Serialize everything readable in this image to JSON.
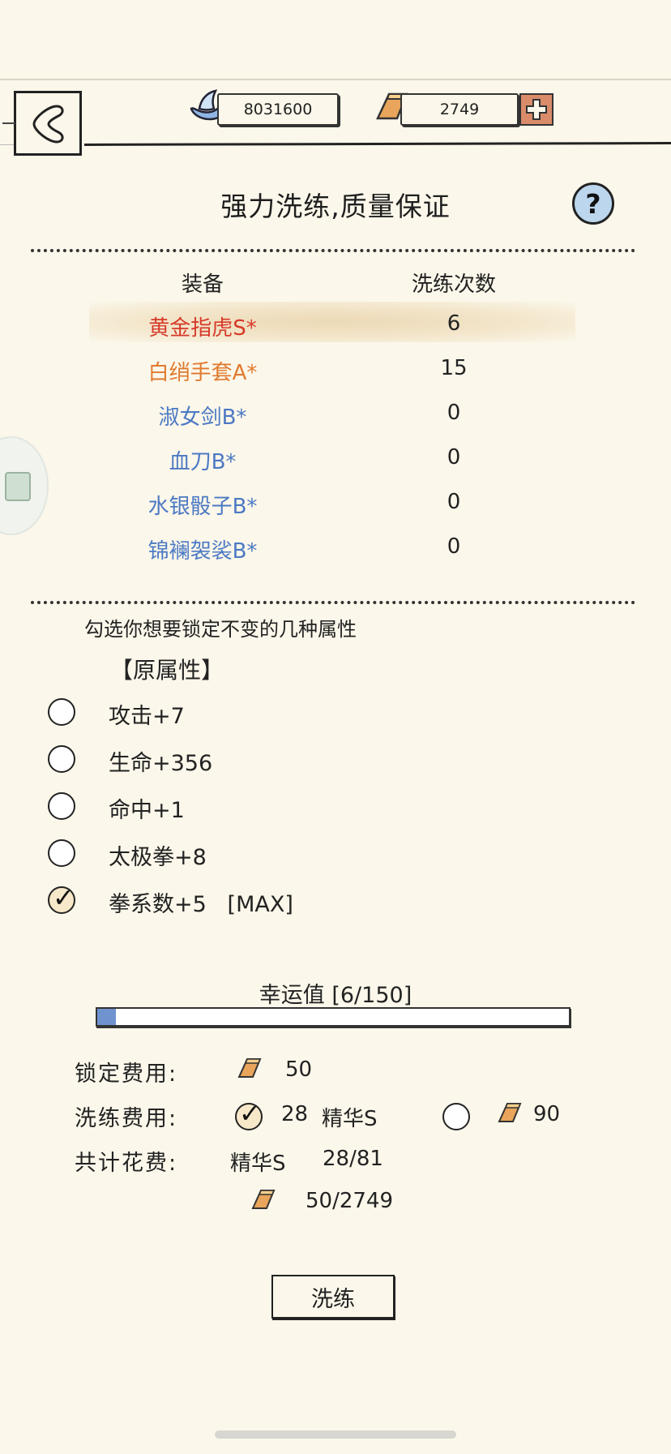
{
  "header": {
    "silver_amount": "8031600",
    "gold_amount": "2749"
  },
  "title": "强力洗练,质量保证",
  "help_symbol": "?",
  "equipment": {
    "col_equip": "装备",
    "col_count": "洗练次数",
    "rows": [
      {
        "name": "黄金指虎S*",
        "count": "6",
        "color": "#d63a2a"
      },
      {
        "name": "白绡手套A*",
        "count": "15",
        "color": "#e07a2e"
      },
      {
        "name": "淑女剑B*",
        "count": "0",
        "color": "#4c79c4"
      },
      {
        "name": "血刀B*",
        "count": "0",
        "color": "#4c79c4"
      },
      {
        "name": "水银骰子B*",
        "count": "0",
        "color": "#4c79c4"
      },
      {
        "name": "锦襕袈裟B*",
        "count": "0",
        "color": "#4c79c4"
      }
    ]
  },
  "lock": {
    "instruction": "勾选你想要锁定不变的几种属性",
    "section_label": "【原属性】",
    "attributes": [
      {
        "label": "攻击+7",
        "checked": false
      },
      {
        "label": "生命+356",
        "checked": false
      },
      {
        "label": "命中+1",
        "checked": false
      },
      {
        "label": "太极拳+8",
        "checked": false
      },
      {
        "label": "拳系数+5   [MAX]",
        "checked": true
      }
    ]
  },
  "luck": {
    "label": "幸运值  [6/150]",
    "value": 6,
    "max": 150
  },
  "costs": {
    "lock_label": "锁定费用:",
    "lock_value": "50",
    "wash_label": "洗练费用:",
    "wash_option1_value": "28",
    "wash_option1_item": "精华S",
    "wash_option2_value": "90",
    "total_label": "共计花费:",
    "total_item": "精华S",
    "total_item_value": "28/81",
    "total_gold_value": "50/2749"
  },
  "wash_button": "洗练",
  "colors": {
    "background": "#fbf7ea",
    "gold": "#e0a25c",
    "luck_fill": "#6f93cf"
  }
}
